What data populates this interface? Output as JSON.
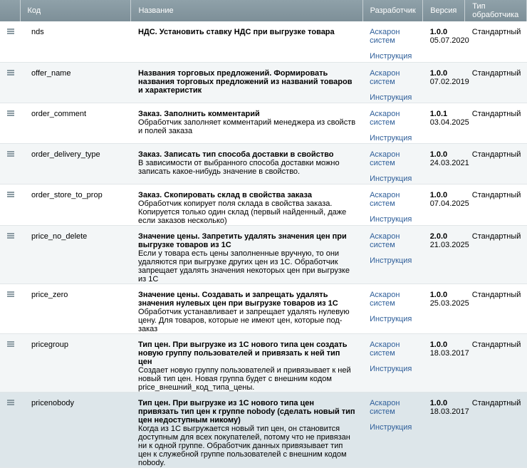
{
  "headers": {
    "code": "Код",
    "name": "Название",
    "developer": "Разработчик",
    "version": "Версия",
    "type_line1": "Тип",
    "type_line2": "обработчика"
  },
  "rows": [
    {
      "code": "nds",
      "title": "НДС. Установить ставку НДС при выгрузке товара",
      "desc": "",
      "dev_line1": "Аскарон",
      "dev_line2": "систем",
      "doc": "Инструкция",
      "version": "1.0.0",
      "date": "05.07.2020",
      "type": "Стандартный"
    },
    {
      "code": "offer_name",
      "title": "Названия торговых предложений. Формировать названия торговых предложений из названий товаров и характеристик",
      "desc": "",
      "dev_line1": "Аскарон",
      "dev_line2": "систем",
      "doc": "Инструкция",
      "version": "1.0.0",
      "date": "07.02.2019",
      "type": "Стандартный"
    },
    {
      "code": "order_comment",
      "title": "Заказ. Заполнить комментарий",
      "desc": "Обработчик заполняет комментарий менеджера из свойств и полей заказа",
      "dev_line1": "Аскарон",
      "dev_line2": "систем",
      "doc": "Инструкция",
      "version": "1.0.1",
      "date": "03.04.2025",
      "type": "Стандартный"
    },
    {
      "code": "order_delivery_type",
      "title": "Заказ. Записать тип способа доставки в свойство",
      "desc": "В зависимости от выбранного способа доставки можно записать какое-нибудь значение в свойство.",
      "dev_line1": "Аскарон",
      "dev_line2": "систем",
      "doc": "Инструкция",
      "version": "1.0.0",
      "date": "24.03.2021",
      "type": "Стандартный"
    },
    {
      "code": "order_store_to_prop",
      "title": "Заказ. Скопировать склад в свойства заказа",
      "desc": "Обработчик копирует поля склада в свойства заказа. Копируется только один склад (первый найденный, даже если заказов несколько)",
      "dev_line1": "Аскарон",
      "dev_line2": "систем",
      "doc": "Инструкция",
      "version": "1.0.0",
      "date": "07.04.2025",
      "type": "Стандартный"
    },
    {
      "code": "price_no_delete",
      "title": "Значение цены. Запретить удалять значения цен при выгрузке товаров из 1С",
      "desc": "Если у товара есть цены заполненные вручную, то они удаляются при выгрузке других цен из 1С. Обработчик запрещает удалять значения некоторых цен при выгрузке из 1С",
      "dev_line1": "Аскарон",
      "dev_line2": "систем",
      "doc": "Инструкция",
      "version": "2.0.0",
      "date": "21.03.2025",
      "type": "Стандартный"
    },
    {
      "code": "price_zero",
      "title": "Значение цены. Создавать и запрещать удалять значения нулевых цен при выгрузке товаров из 1С",
      "desc": "Обработчик устанавливает и запрещает удалять нулевую цену. Для товаров, которые не имеют цен, которые под-заказ",
      "dev_line1": "Аскарон",
      "dev_line2": "систем",
      "doc": "Инструкция",
      "version": "1.0.0",
      "date": "25.03.2025",
      "type": "Стандартный"
    },
    {
      "code": "pricegroup",
      "title": "Тип цен. При выгрузке из 1С нового типа цен создать новую группу пользователей и привязать к ней тип цен",
      "desc": "Создает новую группу пользователей и привязывает к ней новый тип цен. Новая группа будет с внешним кодом price_внешний_код_типа_цены.",
      "dev_line1": "Аскарон",
      "dev_line2": "систем",
      "doc": "Инструкция",
      "version": "1.0.0",
      "date": "18.03.2017",
      "type": "Стандартный"
    },
    {
      "code": "pricenobody",
      "title": "Тип цен. При выгрузке из 1С нового типа цен привязать тип цен к группе nobody (сделать новый тип цен недоступным никому)",
      "desc": "Когда из 1С выгружается новый тип цен, он становится доступным для всех покупателей, потому что не привязан ни к одной группе. Обработчик данных привязывает тип цен к служебной группе пользователей с внешним кодом nobody.",
      "dev_line1": "Аскарон",
      "dev_line2": "систем",
      "doc": "Инструкция",
      "version": "1.0.0",
      "date": "18.03.2017",
      "type": "Стандартный"
    }
  ]
}
